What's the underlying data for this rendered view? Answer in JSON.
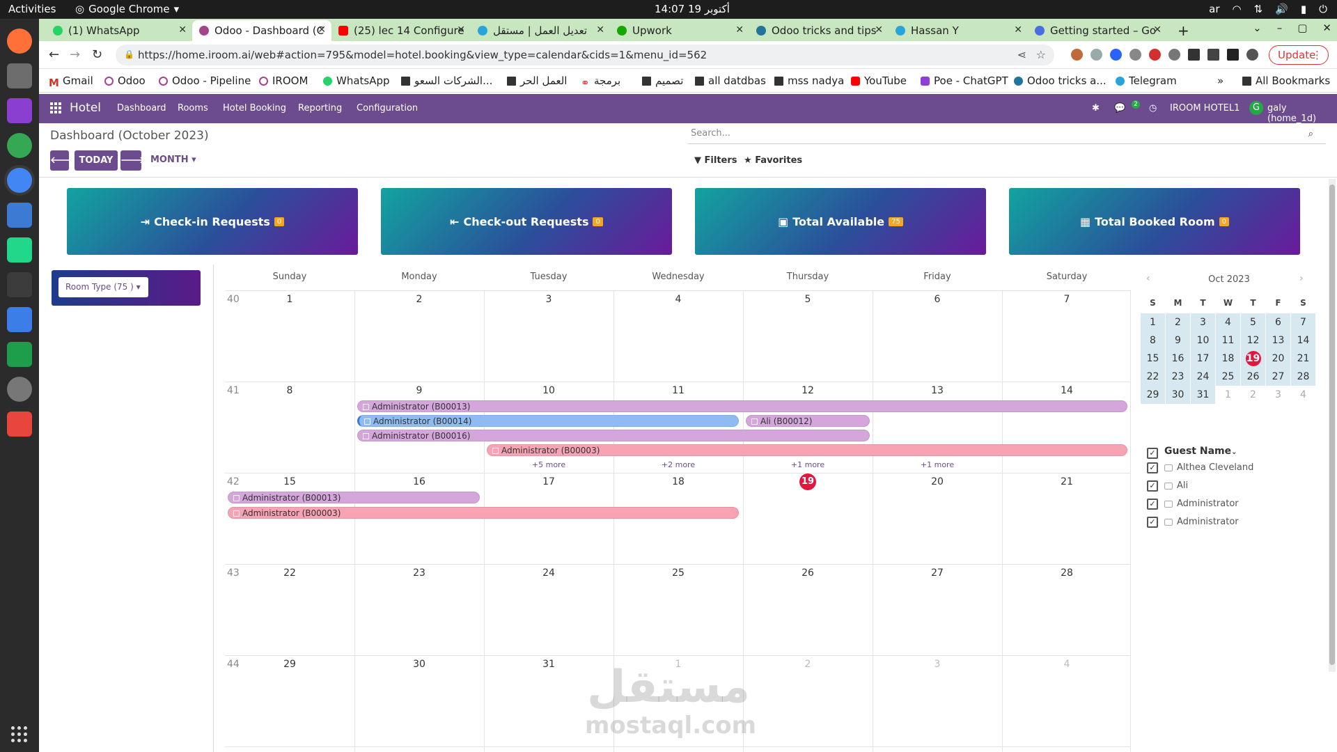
{
  "os": {
    "activities": "Activities",
    "app": "Google Chrome",
    "clock": "14:07  19 أكتوبر",
    "lang": "ar"
  },
  "tabs": [
    {
      "label": "(1) WhatsApp",
      "color": "#25d366"
    },
    {
      "label": "Odoo - Dashboard (C",
      "color": "#a24689"
    },
    {
      "label": "(25) lec 14 Configure",
      "color": "#ff0000"
    },
    {
      "label": "تعديل العمل | مستقل",
      "color": "#2aa3d8"
    },
    {
      "label": "Upwork",
      "color": "#14a800"
    },
    {
      "label": "Odoo tricks and tips",
      "color": "#21759b"
    },
    {
      "label": "Hassan Y",
      "color": "#2aa3d8"
    },
    {
      "label": "Getting started – Go",
      "color": "#4a6ee0"
    }
  ],
  "address": {
    "url": "https://home.iroom.ai/web#action=795&model=hotel.booking&view_type=calendar&cids=1&menu_id=562",
    "update": "Update"
  },
  "bookmarks": [
    "Gmail",
    "Odoo",
    "Odoo - Pipeline",
    "IROOM",
    "WhatsApp",
    "الشركات السعو...",
    "العمل الحر",
    "برمجة",
    "تصميم",
    "all datdbas",
    "mss nadya",
    "YouTube",
    "Poe - ChatGPT",
    "Odoo tricks a...",
    "Telegram",
    "All Bookmarks"
  ],
  "odoo": {
    "brand": "Hotel",
    "menu": [
      "Dashboard",
      "Rooms",
      "Hotel Booking",
      "Reporting",
      "Configuration"
    ],
    "chat_badge": "2",
    "company": "IROOM HOTEL1",
    "user": "galy (home_1d)",
    "user_initial": "G"
  },
  "control": {
    "title": "Dashboard (October 2023)",
    "today": "TODAY",
    "month": "MONTH",
    "search_placeholder": "Search...",
    "filters": "Filters",
    "favorites": "Favorites"
  },
  "cards": [
    {
      "label": "Check-in Requests",
      "count": "0"
    },
    {
      "label": "Check-out Requests",
      "count": "0"
    },
    {
      "label": "Total Available",
      "count": "75"
    },
    {
      "label": "Total Booked Room",
      "count": "0"
    }
  ],
  "room_type": "Room Type (75 )",
  "calendar": {
    "days": [
      "Sunday",
      "Monday",
      "Tuesday",
      "Wednesday",
      "Thursday",
      "Friday",
      "Saturday"
    ],
    "weeks": [
      {
        "no": "40",
        "dates": [
          "1",
          "2",
          "3",
          "4",
          "5",
          "6",
          "7"
        ]
      },
      {
        "no": "41",
        "dates": [
          "8",
          "9",
          "10",
          "11",
          "12",
          "13",
          "14"
        ]
      },
      {
        "no": "42",
        "dates": [
          "15",
          "16",
          "17",
          "18",
          "19",
          "20",
          "21"
        ]
      },
      {
        "no": "43",
        "dates": [
          "22",
          "23",
          "24",
          "25",
          "26",
          "27",
          "28"
        ]
      },
      {
        "no": "44",
        "dates": [
          "29",
          "30",
          "31",
          "1",
          "2",
          "3",
          "4"
        ]
      }
    ],
    "events": [
      {
        "label": "Administrator (B00013)"
      },
      {
        "label": "Administrator (B00014)"
      },
      {
        "label": "Ali (B00012)"
      },
      {
        "label": "Administrator (B00016)"
      },
      {
        "label": "Administrator (B00003)"
      },
      {
        "label": "Administrator (B00013)"
      },
      {
        "label": "Administrator (B00003)"
      }
    ],
    "more": [
      "+5 more",
      "+2 more",
      "+1 more",
      "+1 more"
    ]
  },
  "mini": {
    "title": "Oct 2023",
    "weekdays": [
      "S",
      "M",
      "T",
      "W",
      "T",
      "F",
      "S"
    ],
    "rows": [
      [
        "1",
        "2",
        "3",
        "4",
        "5",
        "6",
        "7"
      ],
      [
        "8",
        "9",
        "10",
        "11",
        "12",
        "13",
        "14"
      ],
      [
        "15",
        "16",
        "17",
        "18",
        "19",
        "20",
        "21"
      ],
      [
        "22",
        "23",
        "24",
        "25",
        "26",
        "27",
        "28"
      ],
      [
        "29",
        "30",
        "31",
        "1",
        "2",
        "3",
        "4"
      ]
    ]
  },
  "guests": {
    "title": "Guest Name",
    "items": [
      "Althea Cleveland",
      "Ali",
      "Administrator",
      "Administrator"
    ]
  },
  "watermark": {
    "ar": "مستقل",
    "en": "mostaql.com"
  }
}
